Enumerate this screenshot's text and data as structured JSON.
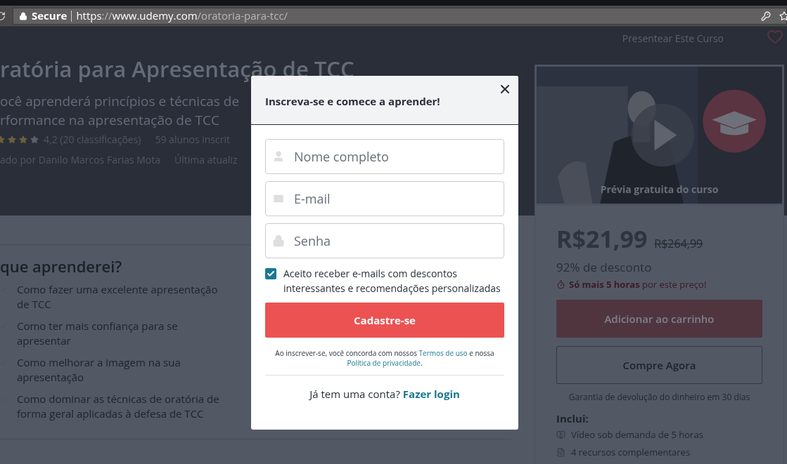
{
  "browser": {
    "secure_label": "Secure",
    "url_parts": [
      {
        "text": "https",
        "dim": false
      },
      {
        "text": "://",
        "dim": true
      },
      {
        "text": "www.udemy.com",
        "dim": false
      },
      {
        "text": "/oratoria-para-tcc/",
        "dim": true
      }
    ]
  },
  "course": {
    "title": "ratória para Apresentação de TCC",
    "subtitle_lines": [
      "ocê aprenderá princípios e técnicas de",
      "rformance na apresentação de TCC"
    ],
    "stars": 3,
    "rating": "4,2 (20 classificações)",
    "students": "59 alunos inscrit",
    "author": "ado por Danilo Marcos Farias Mota",
    "updated": "Última atualiz"
  },
  "gift_label": "Presentear Este Curso",
  "preview_caption": "Prévia gratuita do curso",
  "pricing": {
    "price": "R$21,99",
    "original_price": "R$264,99",
    "discount": "92% de desconto",
    "urgency": "**Só mais 5 horas** por este preço!",
    "add_to_cart": "Adicionar ao carrinho",
    "buy_now": "Compre Agora",
    "guarantee": "Garantia de devolução do dinheiro em 30 dias",
    "includes_title": "Inclui:",
    "includes": [
      {
        "kind": "video",
        "text": "Vídeo sob demanda de 5 horas"
      },
      {
        "kind": "file",
        "text": "4 recursos complementares"
      }
    ]
  },
  "learn": {
    "title": "que aprenderei?",
    "items": [
      "Como fazer uma excelente apresentação de TCC",
      "Como ter mais confiança para se apresentar",
      "Como melhorar a imagem na sua apresentação",
      "Como dominar as técnicas de oratória de forma geral aplicadas à defesa de TCC"
    ]
  },
  "modal": {
    "title": "Inscreva-se e comece a aprender!",
    "fields": [
      {
        "kind": "user",
        "placeholder": "Nome completo"
      },
      {
        "kind": "email",
        "placeholder": "E-mail"
      },
      {
        "kind": "password",
        "placeholder": "Senha"
      }
    ],
    "consent": {
      "checked": true,
      "label": "Aceito receber e-mails com descontos interessantes e recomendações personalizadas"
    },
    "submit": "Cadastre-se",
    "terms": {
      "before": "Ao inscrever-se, você concorda com nossos ",
      "terms_link": "Termos de uso",
      "middle": " e nossa ",
      "privacy_link": "Política de privacidade",
      "after": "."
    },
    "login": {
      "prompt": "Já tem uma conta?",
      "link": "Fazer login"
    }
  }
}
